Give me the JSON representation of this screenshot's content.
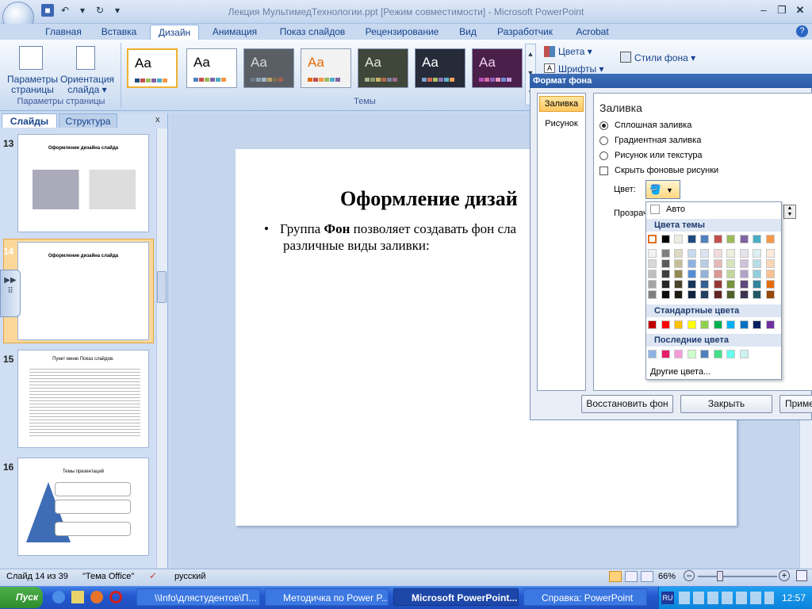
{
  "window": {
    "title": "Лекция МультимедТехнологии.ppt [Режим совместимости] - Microsoft PowerPoint"
  },
  "ribbon_tabs": [
    "Главная",
    "Вставка",
    "Дизайн",
    "Анимация",
    "Показ слайдов",
    "Рецензирование",
    "Вид",
    "Разработчик",
    "Acrobat"
  ],
  "ribbon": {
    "page_setup": {
      "btn1_line1": "Параметры",
      "btn1_line2": "страницы",
      "btn2_line1": "Ориентация",
      "btn2_line2": "слайда ▾",
      "group": "Параметры страницы"
    },
    "themes": {
      "group": "Темы",
      "aa": "Aa"
    },
    "colors_label": "Цвета ▾",
    "fonts_label": "Шрифты ▾",
    "bg_styles_label": "Стили фона ▾"
  },
  "theme_swatches": [
    {
      "bg": "#ffffff",
      "fg": "#000000",
      "sw": [
        "#1f497d",
        "#c0504d",
        "#9bbb59",
        "#8064a2",
        "#4bacc6",
        "#f79646"
      ]
    },
    {
      "bg": "#ffffff",
      "fg": "#000000",
      "sw": [
        "#4f81bd",
        "#c0504d",
        "#9bbb59",
        "#8064a2",
        "#4bacc6",
        "#f79646"
      ]
    },
    {
      "bg": "#5a5f66",
      "fg": "#d8d8d8",
      "sw": [
        "#6e7a8a",
        "#8aa1b1",
        "#a5b5c1",
        "#b8a26b",
        "#7e6f52",
        "#a3614c"
      ]
    },
    {
      "bg": "#f2f2f2",
      "fg": "#e36c09",
      "sw": [
        "#e36c09",
        "#c0504d",
        "#f79646",
        "#9bbb59",
        "#4bacc6",
        "#8064a2"
      ]
    },
    {
      "bg": "#3f463a",
      "fg": "#e6e6d8",
      "sw": [
        "#a5b592",
        "#8c9b6a",
        "#c8b46a",
        "#b36b4f",
        "#7a7f9e",
        "#9e6a8c"
      ]
    },
    {
      "bg": "#262b3a",
      "fg": "#ffffff",
      "sw": [
        "#7ba0cd",
        "#d06a56",
        "#a9c266",
        "#8e74b3",
        "#5fb3cf",
        "#f5a25a"
      ]
    },
    {
      "bg": "#4a1f4a",
      "fg": "#f0d0f0",
      "sw": [
        "#b84db8",
        "#d66fa8",
        "#8f5fbf",
        "#e89ac0",
        "#6f8fd8",
        "#c7a0e0"
      ]
    }
  ],
  "left_panel": {
    "tab_slides": "Слайды",
    "tab_outline": "Структура",
    "close": "x",
    "slides": [
      {
        "num": "13",
        "title": "Оформление дизайна слайда"
      },
      {
        "num": "14",
        "title": "Оформление дизайна слайда"
      },
      {
        "num": "15",
        "title": "Пункт меню Показ слайдов."
      },
      {
        "num": "16",
        "title": "Темы презентаций"
      }
    ]
  },
  "slide": {
    "title": "Оформление дизай",
    "bullet": "•",
    "text_before": "Группа ",
    "text_bold": "Фон",
    "text_after": " позволяет создавать фон сла",
    "text_line2": "различные виды заливки:"
  },
  "dialog": {
    "title": "Формат фона",
    "nav_fill": "Заливка",
    "nav_picture": "Рисунок",
    "section": "Заливка",
    "opt_solid": "Сплошная заливка",
    "opt_gradient": "Градиентная заливка",
    "opt_picture": "Рисунок или текстура",
    "opt_hide": "Скрыть фоновые рисунки",
    "color_label": "Цвет:",
    "transparency_label": "Прозрач",
    "btn_reset": "Восстановить фон",
    "btn_close": "Закрыть",
    "btn_apply": "Приме"
  },
  "color_popup": {
    "auto": "Авто",
    "theme_colors": "Цвета темы",
    "standard_colors": "Стандартные цвета",
    "recent_colors": "Последние цвета",
    "more": "Другие цвета...",
    "theme_row": [
      "#ffffff",
      "#000000",
      "#eeece1",
      "#1f497d",
      "#4f81bd",
      "#c0504d",
      "#9bbb59",
      "#8064a2",
      "#4bacc6",
      "#f79646"
    ],
    "theme_shades": [
      [
        "#f2f2f2",
        "#7f7f7f",
        "#ddd9c3",
        "#c6d9f0",
        "#dbe5f1",
        "#f2dcdb",
        "#ebf1dd",
        "#e5e0ec",
        "#dbeef3",
        "#fdeada"
      ],
      [
        "#d8d8d8",
        "#595959",
        "#c4bd97",
        "#8db3e2",
        "#b8cce4",
        "#e5b9b7",
        "#d7e3bc",
        "#ccc1d9",
        "#b7dde8",
        "#fbd5b5"
      ],
      [
        "#bfbfbf",
        "#3f3f3f",
        "#938953",
        "#548dd4",
        "#95b3d7",
        "#d99694",
        "#c3d69b",
        "#b2a2c7",
        "#92cddc",
        "#fac08f"
      ],
      [
        "#a5a5a5",
        "#262626",
        "#494429",
        "#17365d",
        "#366092",
        "#953734",
        "#76923c",
        "#5f497a",
        "#31859b",
        "#e36c09"
      ],
      [
        "#7f7f7f",
        "#0c0c0c",
        "#1d1b10",
        "#0f243e",
        "#244061",
        "#632423",
        "#4f6128",
        "#3f3151",
        "#205867",
        "#974806"
      ]
    ],
    "standard": [
      "#c00000",
      "#ff0000",
      "#ffc000",
      "#ffff00",
      "#92d050",
      "#00b050",
      "#00b0f0",
      "#0070c0",
      "#002060",
      "#7030a0"
    ],
    "recent": [
      "#8db3e2",
      "#e81c6b",
      "#f59bd8",
      "#ccffcc",
      "#4f81bd",
      "#44dd88",
      "#66ffee",
      "#ccf2f2"
    ]
  },
  "status": {
    "slide_pos": "Слайд 14 из 39",
    "theme": "\"Тема Office\"",
    "lang": "русский",
    "zoom": "66%"
  },
  "taskbar": {
    "start": "Пуск",
    "items": [
      "\\\\Info\\длястудентов\\П...",
      "Методичка по Power P...",
      "Microsoft PowerPoint...",
      "Справка: PowerPoint"
    ],
    "lang": "RU",
    "time": "12:57"
  }
}
